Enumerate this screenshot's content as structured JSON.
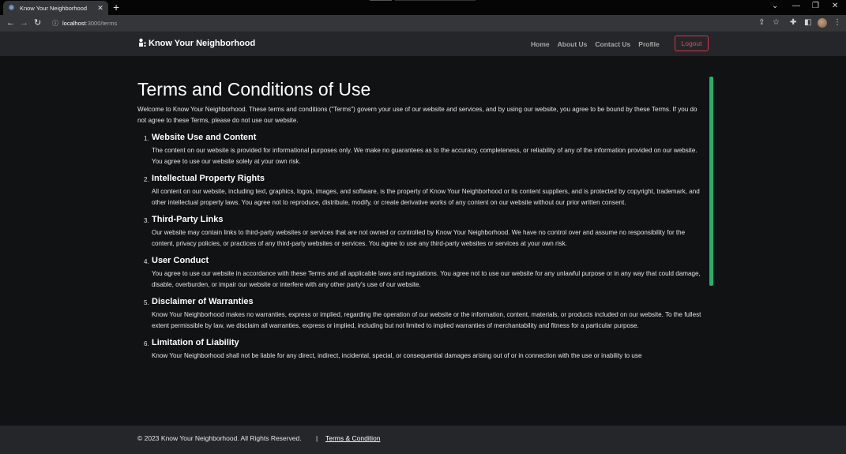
{
  "browser": {
    "tab_title": "Know Your Neighborhood",
    "new_tab": "+",
    "url_host": "localhost",
    "url_path": ":3000/terms",
    "window_controls": [
      "⌄",
      "—",
      "❐",
      "✕"
    ]
  },
  "navbar": {
    "brand": "Know Your Neighborhood",
    "links": [
      "Home",
      "About Us",
      "Contact Us",
      "Profile"
    ],
    "logout": "Logout"
  },
  "page": {
    "title": "Terms and Conditions of Use",
    "intro": "Welcome to Know Your Neighborhood. These terms and conditions (\"Terms\") govern your use of our website and services, and by using our website, you agree to be bound by these Terms. If you do not agree to these Terms, please do not use our website.",
    "sections": [
      {
        "num": "1.",
        "heading": "Website Use and Content",
        "body": "The content on our website is provided for informational purposes only. We make no guarantees as to the accuracy, completeness, or reliability of any of the information provided on our website. You agree to use our website solely at your own risk."
      },
      {
        "num": "2.",
        "heading": "Intellectual Property Rights",
        "body": "All content on our website, including text, graphics, logos, images, and software, is the property of Know Your Neighborhood or its content suppliers, and is protected by copyright, trademark, and other intellectual property laws. You agree not to reproduce, distribute, modify, or create derivative works of any content on our website without our prior written consent."
      },
      {
        "num": "3.",
        "heading": "Third-Party Links",
        "body": "Our website may contain links to third-party websites or services that are not owned or controlled by Know Your Neighborhood. We have no control over and assume no responsibility for the content, privacy policies, or practices of any third-party websites or services. You agree to use any third-party websites or services at your own risk."
      },
      {
        "num": "4.",
        "heading": "User Conduct",
        "body": "You agree to use our website in accordance with these Terms and all applicable laws and regulations. You agree not to use our website for any unlawful purpose or in any way that could damage, disable, overburden, or impair our website or interfere with any other party's use of our website."
      },
      {
        "num": "5.",
        "heading": "Disclaimer of Warranties",
        "body": "Know Your Neighborhood makes no warranties, express or implied, regarding the operation of our website or the information, content, materials, or products included on our website. To the fullest extent permissible by law, we disclaim all warranties, express or implied, including but not limited to implied warranties of merchantability and fitness for a particular purpose."
      },
      {
        "num": "6.",
        "heading": "Limitation of Liability",
        "body": "Know Your Neighborhood shall not be liable for any direct, indirect, incidental, special, or consequential damages arising out of or in connection with the use or inability to use"
      }
    ]
  },
  "footer": {
    "copyright": "© 2023 Know Your Neighborhood. All Rights Reserved.",
    "separator": "|",
    "terms_link": "Terms & Condition"
  },
  "colors": {
    "background": "#111214",
    "navbar": "#24262a",
    "logout": "#dc3545",
    "scrollbar": "#21b36a"
  }
}
